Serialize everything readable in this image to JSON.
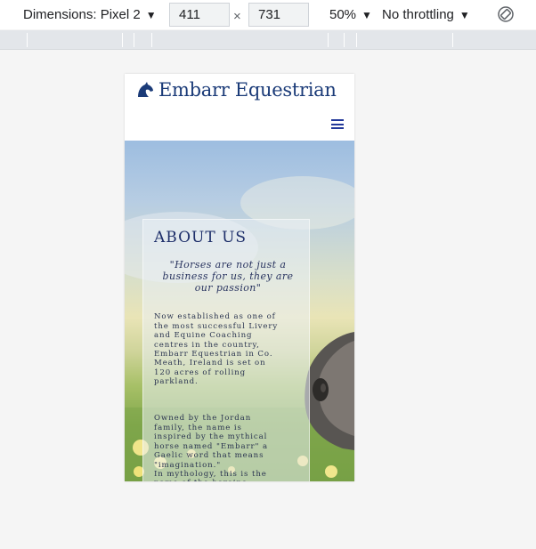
{
  "devtools": {
    "device_label": "Dimensions: Pixel 2",
    "width_value": "411",
    "height_value": "731",
    "times_sign": "×",
    "zoom_label": "50%",
    "throttling_label": "No throttling",
    "caret": "▼"
  },
  "site": {
    "brand_name": "Embarr Equestrian",
    "about": {
      "title": "ABOUT US",
      "quote": "\"Horses are not just a business for us, they are our passion\"",
      "paragraph1": "Now established as one of\nthe most successful Livery\nand Equine Coaching\ncentres in the country,\nEmbarr Equestrian in Co.\nMeath, Ireland is set on\n120 acres of rolling\nparkland.",
      "paragraph2": "Owned by the Jordan\nfamily, the name is\ninspired by the mythical\nhorse named \"Embarr\" a\nGaelic word that means\n\"imagination.\"\nIn mythology, this is the\nname of the heroine\nNiamh's magical horse that\ncould cross the sea and\nland without touching the\nwater or the ground."
    }
  },
  "colors": {
    "brand_blue": "#1b3b78",
    "menu_blue": "#23399a"
  }
}
